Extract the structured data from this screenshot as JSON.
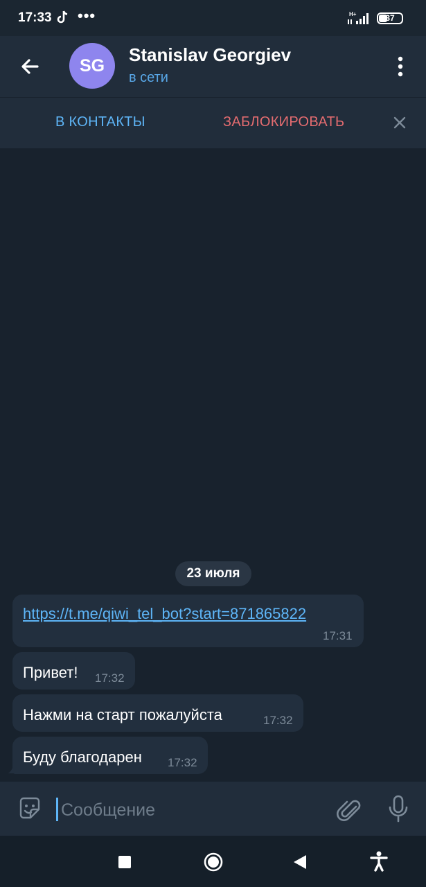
{
  "status_bar": {
    "time": "17:33",
    "dots": "•••",
    "battery": "37",
    "signal": "H+",
    "icons": [
      "tiktok-icon",
      "signal-icon",
      "battery-icon"
    ]
  },
  "header": {
    "avatar_initials": "SG",
    "avatar_color": "#8e85ee",
    "name": "Stanislav Georgiev",
    "status": "в сети",
    "icons": [
      "back-arrow-icon",
      "more-vertical-icon"
    ]
  },
  "action_bar": {
    "add_contact": "В КОНТАКТЫ",
    "block": "ЗАБЛОКИРОВАТЬ",
    "icons": [
      "close-icon"
    ]
  },
  "chat": {
    "date": "23 июля",
    "messages": [
      {
        "text": "https://t.me/qiwi_tel_bot?start=871865822",
        "time": "17:31",
        "is_link": true
      },
      {
        "text": "Привет!",
        "time": "17:32"
      },
      {
        "text": "Нажми на старт пожалуйста",
        "time": "17:32"
      },
      {
        "text": "Буду благодарен",
        "time": "17:32"
      }
    ]
  },
  "input": {
    "placeholder": "Сообщение",
    "value": "",
    "icons": [
      "sticker-icon",
      "attach-icon",
      "microphone-icon"
    ]
  },
  "nav_bar": {
    "icons": [
      "recents-icon",
      "home-icon",
      "back-icon",
      "accessibility-icon"
    ]
  },
  "colors": {
    "background": "#18222d",
    "header": "#212d3b",
    "bubble": "#222f3e",
    "accent": "#5eb5f7",
    "danger": "#e56c70"
  }
}
